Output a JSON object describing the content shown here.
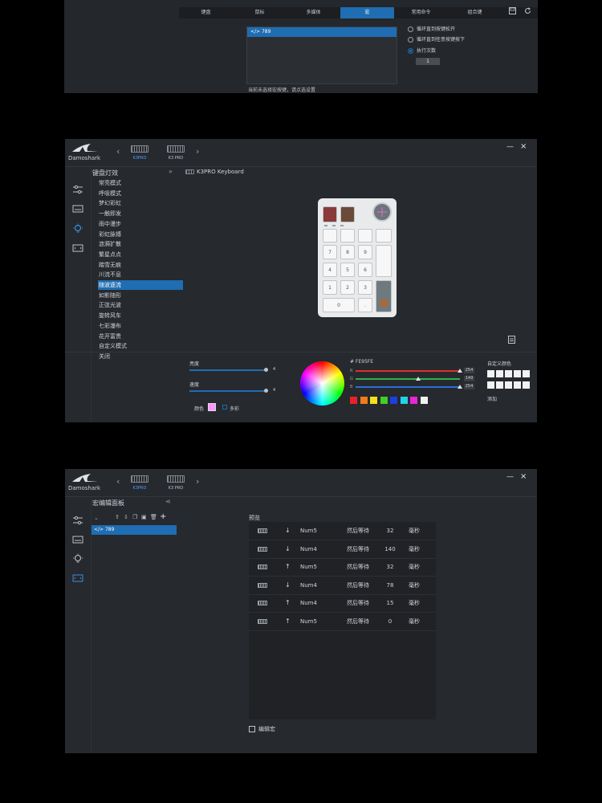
{
  "panel1": {
    "tabs": [
      {
        "label": "键盘",
        "active": false
      },
      {
        "label": "鼠标",
        "active": false
      },
      {
        "label": "多媒体",
        "active": false
      },
      {
        "label": "宏",
        "active": true
      },
      {
        "label": "常用命令",
        "active": false
      },
      {
        "label": "组合键",
        "active": false
      }
    ],
    "macro_item": "</> 789",
    "options": [
      {
        "label": "循环直到按键松开",
        "selected": false
      },
      {
        "label": "循环直到任意按键按下",
        "selected": false
      },
      {
        "label": "执行次数",
        "selected": true
      }
    ],
    "count_value": "1",
    "hint": "当前未选择宏按键，请点选设置"
  },
  "panel2": {
    "brand": "Damoshark",
    "devices": [
      "K3PRO",
      "K3 PRO"
    ],
    "category_title": "键盘灯效",
    "effects": [
      "常亮模式",
      "呼吸模式",
      "梦幻彩虹",
      "一触即发",
      "雨中漫步",
      "彩虹脉搏",
      "涟漪扩散",
      "繁星点点",
      "踏雪无痕",
      "川流不息",
      "随波逐流",
      "如影随形",
      "正弦光波",
      "旋转风车",
      "七彩瀑布",
      "花开富贵",
      "自定义模式",
      "关闭"
    ],
    "active_effect": 10,
    "keyboard_label": "K3PRO Keyboard",
    "keys": [
      "",
      "",
      "",
      "",
      "",
      "",
      "7",
      "8",
      "9",
      "4",
      "5",
      "6",
      "1",
      "2",
      "3",
      "0",
      "."
    ],
    "brightness_label": "亮度",
    "speed_label": "速度",
    "brightness_value": 4,
    "speed_value": 4,
    "color_label": "颜色",
    "multicolor_label": "多彩",
    "hex_label": "# FE95FE",
    "rgb": [
      {
        "channel": "R",
        "value": 254,
        "color": "#e0312a"
      },
      {
        "channel": "G",
        "value": 149,
        "color": "#2fb24a"
      },
      {
        "channel": "B",
        "value": 254,
        "color": "#2b6fd8"
      }
    ],
    "palette": [
      "#e8212a",
      "#f07c1a",
      "#f3df1b",
      "#3fce2a",
      "#1c3fe0",
      "#21d2e8",
      "#e826d6",
      "#f2f2f2"
    ],
    "custom_color_label": "自定义颜色",
    "add_label": "添加"
  },
  "panel3": {
    "brand": "Damoshark",
    "devices": [
      "K3PRO",
      "K3 PRO"
    ],
    "title": "宏编辑面板",
    "macro_item": "</> 789",
    "preview_label": "预览",
    "rows": [
      {
        "dir": "down",
        "key": "Num5",
        "action": "然后等待",
        "ms": "32",
        "unit": "毫秒"
      },
      {
        "dir": "down",
        "key": "Num4",
        "action": "然后等待",
        "ms": "140",
        "unit": "毫秒"
      },
      {
        "dir": "up",
        "key": "Num5",
        "action": "然后等待",
        "ms": "32",
        "unit": "毫秒"
      },
      {
        "dir": "down",
        "key": "Num4",
        "action": "然后等待",
        "ms": "78",
        "unit": "毫秒"
      },
      {
        "dir": "up",
        "key": "Num4",
        "action": "然后等待",
        "ms": "15",
        "unit": "毫秒"
      },
      {
        "dir": "up",
        "key": "Num5",
        "action": "然后等待",
        "ms": "0",
        "unit": "毫秒"
      }
    ],
    "edit_label": "编辑宏"
  },
  "colors": {
    "accent": "#1f6db2",
    "panel": "#26292e"
  }
}
